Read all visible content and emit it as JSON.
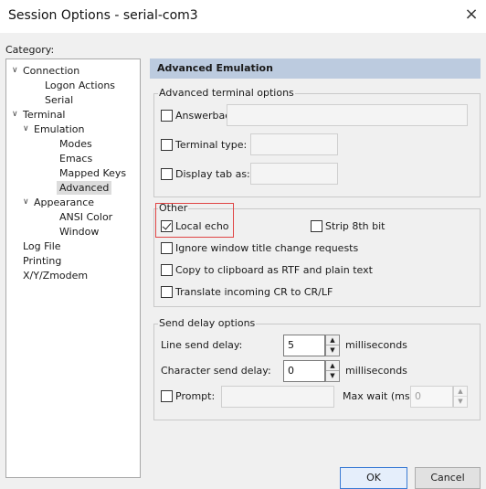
{
  "window": {
    "title": "Session Options - serial-com3",
    "close_glyph": "×"
  },
  "category": {
    "label": "Category:",
    "tree": [
      {
        "label": "Connection",
        "expanded": true
      },
      {
        "label": "Logon Actions"
      },
      {
        "label": "Serial"
      },
      {
        "label": "Terminal",
        "expanded": true
      },
      {
        "label": "Emulation",
        "expanded": true
      },
      {
        "label": "Modes"
      },
      {
        "label": "Emacs"
      },
      {
        "label": "Mapped Keys"
      },
      {
        "label": "Advanced",
        "selected": true
      },
      {
        "label": "Appearance",
        "expanded": true
      },
      {
        "label": "ANSI Color"
      },
      {
        "label": "Window"
      },
      {
        "label": "Log File"
      },
      {
        "label": "Printing"
      },
      {
        "label": "X/Y/Zmodem"
      }
    ]
  },
  "panel": {
    "header": "Advanced Emulation",
    "advanced_terminal": {
      "title": "Advanced terminal options",
      "answerback": {
        "label": "Answerback:",
        "checked": false,
        "value": ""
      },
      "terminal_type": {
        "label": "Terminal type:",
        "checked": false,
        "value": ""
      },
      "display_tab": {
        "label": "Display tab as:",
        "checked": false,
        "value": ""
      }
    },
    "other": {
      "title": "Other",
      "local_echo": {
        "label": "Local echo",
        "checked": true
      },
      "strip_8th_bit": {
        "label": "Strip 8th bit",
        "checked": false
      },
      "ignore_title": {
        "label": "Ignore window title change requests",
        "checked": false
      },
      "copy_rtf": {
        "label": "Copy to clipboard as RTF and plain text",
        "checked": false
      },
      "translate_cr": {
        "label": "Translate incoming CR to CR/LF",
        "checked": false
      }
    },
    "send_delay": {
      "title": "Send delay options",
      "line_delay": {
        "label": "Line send delay:",
        "value": "5",
        "unit": "milliseconds"
      },
      "char_delay": {
        "label": "Character send delay:",
        "value": "0",
        "unit": "milliseconds"
      },
      "prompt": {
        "label": "Prompt:",
        "checked": false,
        "value": ""
      },
      "max_wait": {
        "label": "Max wait (ms)",
        "value": "0"
      }
    }
  },
  "buttons": {
    "ok": "OK",
    "cancel": "Cancel"
  },
  "icons": {
    "chevron": "chevron-down-icon",
    "spin_up": "▲",
    "spin_down": "▼"
  },
  "colors": {
    "header_bg": "#bccbdf",
    "highlight": "#e04545",
    "primary_border": "#3b7bd4"
  }
}
